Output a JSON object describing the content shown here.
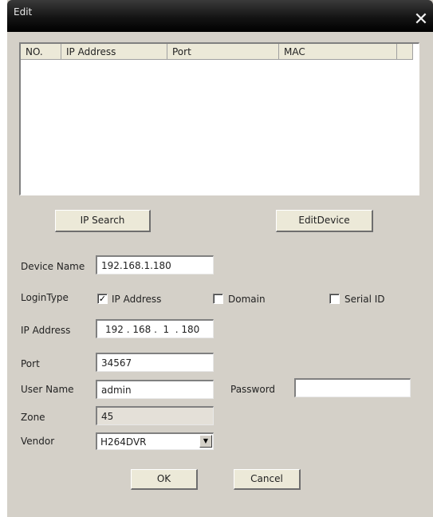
{
  "window": {
    "title": "Edit"
  },
  "list": {
    "columns": [
      "NO.",
      "IP Address",
      "Port",
      "MAC"
    ],
    "rows": []
  },
  "buttons": {
    "ip_search": "IP Search",
    "edit_device": "EditDevice",
    "ok": "OK",
    "cancel": "Cancel"
  },
  "form": {
    "device_name": {
      "label": "Device Name",
      "value": "192.168.1.180"
    },
    "login_type": {
      "label": "LoginType",
      "options": [
        {
          "label": "IP Address",
          "checked": true
        },
        {
          "label": "Domain",
          "checked": false
        },
        {
          "label": "Serial ID",
          "checked": false
        }
      ]
    },
    "ip_address": {
      "label": "IP Address",
      "value": "192 . 168 .  1  . 180"
    },
    "port": {
      "label": "Port",
      "value": "34567"
    },
    "user_name": {
      "label": "User Name",
      "value": "admin"
    },
    "password": {
      "label": "Password",
      "value": ""
    },
    "zone": {
      "label": "Zone",
      "value": "45"
    },
    "vendor": {
      "label": "Vendor",
      "value": "H264DVR"
    }
  }
}
